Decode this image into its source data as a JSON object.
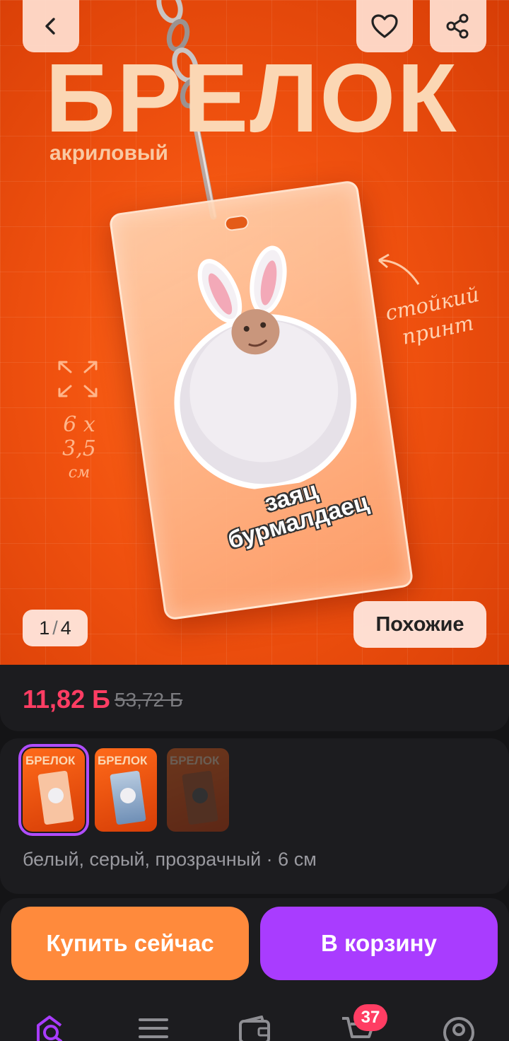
{
  "hero": {
    "title": "БРЕЛОК",
    "subtitle": "акриловый",
    "tag_caption_line1": "заяц",
    "tag_caption_line2": "бурмалдаец",
    "annotation_print_line1": "стойкий",
    "annotation_print_line2": "принт",
    "annotation_size": "6 x 3,5",
    "annotation_unit": "см",
    "counter_current": "1",
    "counter_separator": "/",
    "counter_total": "4",
    "similar_label": "Похожие"
  },
  "price": {
    "current": "11,82 ",
    "currency": "Ƃ",
    "old": "53,72 Ƃ"
  },
  "variants": {
    "thumb_title": "БРЕЛОК",
    "description": "белый, серый, прозрачный · 6 см"
  },
  "actions": {
    "buy_now": "Купить сейчас",
    "add_to_cart": "В корзину"
  },
  "nav": {
    "cart_badge": "37"
  },
  "icons": {
    "back": "chevron-left-icon",
    "favorite": "heart-icon",
    "share": "share-icon",
    "home": "search-home-icon",
    "catalog": "menu-icon",
    "wallet": "wallet-icon",
    "cart": "cart-icon",
    "profile": "profile-icon"
  },
  "colors": {
    "hero_orange": "#f0510f",
    "price_red": "#ff3d63",
    "buy_orange": "#ff8a3c",
    "cart_purple": "#a93cff",
    "selected_outline": "#b04dff"
  }
}
